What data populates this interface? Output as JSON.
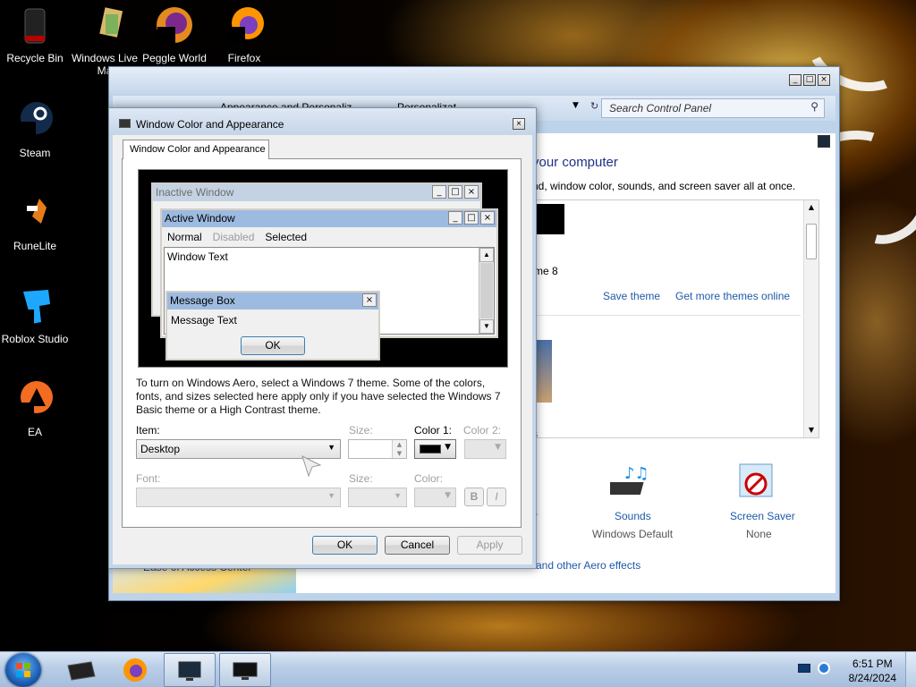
{
  "desktop": {
    "icons": [
      {
        "label": "Recycle Bin",
        "icon": "recycle-bin-icon"
      },
      {
        "label": "Windows Live",
        "label2": "Ma",
        "icon": "windows-live-icon"
      },
      {
        "label": "Peggle World",
        "icon": "peggle-icon"
      },
      {
        "label": "Firefox",
        "icon": "firefox-icon"
      },
      {
        "label": "Steam",
        "icon": "steam-icon"
      },
      {
        "label": "RuneLite",
        "icon": "runelite-icon"
      },
      {
        "label": "Roblox Studio",
        "icon": "roblox-studio-icon"
      },
      {
        "label": "EA",
        "icon": "ea-icon"
      }
    ]
  },
  "control_panel": {
    "breadcrumb_1": "Appearance and Personaliz",
    "breadcrumb_2": "Personalizat",
    "search_placeholder": "Search Control Panel",
    "heading": "your computer",
    "subheading": "nd, window color, sounds, and screen saver all at once.",
    "theme_name_fragment": "me 8",
    "theme_fragment_2": "s",
    "save_theme": "Save theme",
    "get_more_themes": "Get more themes online",
    "color_fragment": "r",
    "sounds_label": "Sounds",
    "sounds_value": "Windows Default",
    "screensaver_label": "Screen Saver",
    "screensaver_value": "None",
    "aero_link": "and other Aero effects",
    "ease_of_access": "Ease of Access Center"
  },
  "dialog": {
    "title": "Window Color and Appearance",
    "tab": "Window Color and Appearance",
    "preview": {
      "inactive_title": "Inactive Window",
      "active_title": "Active Window",
      "menu_normal": "Normal",
      "menu_disabled": "Disabled",
      "menu_selected": "Selected",
      "window_text": "Window Text",
      "msgbox_title": "Message Box",
      "msgbox_text": "Message Text",
      "msgbox_ok": "OK"
    },
    "description": "To turn on Windows Aero, select a Windows 7 theme.  Some of the colors, fonts, and sizes selected here apply only if you have selected the Windows 7 Basic theme or a High Contrast theme.",
    "item_label": "Item:",
    "item_value": "Desktop",
    "size_label": "Size:",
    "color1_label": "Color 1:",
    "color2_label": "Color 2:",
    "font_label": "Font:",
    "font_size_label": "Size:",
    "font_color_label": "Color:",
    "bold_label": "B",
    "italic_label": "I",
    "color1_value": "#000000",
    "ok_button": "OK",
    "cancel_button": "Cancel",
    "apply_button": "Apply"
  },
  "taskbar": {
    "time": "6:51 PM",
    "date": "8/24/2024"
  }
}
